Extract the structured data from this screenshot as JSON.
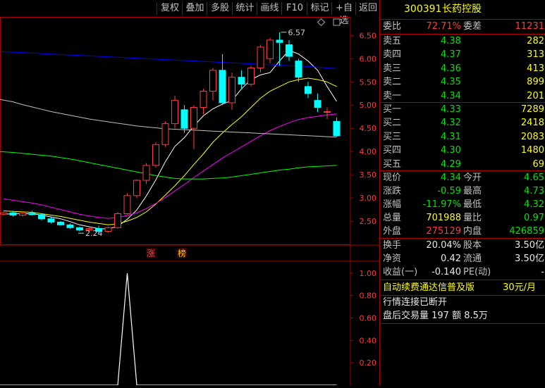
{
  "toolbar": {
    "buttons": [
      "复权",
      "叠加",
      "多股",
      "统计",
      "画线",
      "F10",
      "标记",
      "+自选",
      "返回"
    ]
  },
  "stock": {
    "code": "300391",
    "name": "长药控股"
  },
  "colors": {
    "up": "#ff3c3c",
    "down": "#00ffff",
    "ma5": "#ffffff",
    "ma10": "#ffff00",
    "ma20": "#ff00ff",
    "ma60": "#00ff00",
    "ma120": "#c0c0c0",
    "ma250": "#0000ff"
  },
  "committee": {
    "ratio_label": "委比",
    "ratio": "72.71%",
    "diff_label": "委差",
    "diff": "11231"
  },
  "asks": [
    {
      "label": "卖五",
      "price": "4.38",
      "vol": "282"
    },
    {
      "label": "卖四",
      "price": "4.37",
      "vol": "313"
    },
    {
      "label": "卖三",
      "price": "4.36",
      "vol": "413"
    },
    {
      "label": "卖二",
      "price": "4.35",
      "vol": "899"
    },
    {
      "label": "卖一",
      "price": "4.34",
      "vol": "201"
    }
  ],
  "bids": [
    {
      "label": "买一",
      "price": "4.33",
      "vol": "7289"
    },
    {
      "label": "买二",
      "price": "4.32",
      "vol": "2418"
    },
    {
      "label": "买三",
      "price": "4.31",
      "vol": "2083"
    },
    {
      "label": "买四",
      "price": "4.30",
      "vol": "1480"
    },
    {
      "label": "买五",
      "price": "4.29",
      "vol": "69"
    }
  ],
  "quote": [
    {
      "l1": "现价",
      "v1": "4.34",
      "c1": "green",
      "l2": "今开",
      "v2": "4.65",
      "c2": "green"
    },
    {
      "l1": "涨跌",
      "v1": "-0.59",
      "c1": "green",
      "l2": "最高",
      "v2": "4.73",
      "c2": "green"
    },
    {
      "l1": "涨幅",
      "v1": "-11.97%",
      "c1": "green",
      "l2": "最低",
      "v2": "4.32",
      "c2": "green"
    },
    {
      "l1": "总量",
      "v1": "701988",
      "c1": "yellow",
      "l2": "量比",
      "v2": "0.97",
      "c2": "green"
    },
    {
      "l1": "外盘",
      "v1": "275129",
      "c1": "red",
      "l2": "内盘",
      "v2": "426859",
      "c2": "green"
    }
  ],
  "fundamentals": [
    {
      "l1": "换手",
      "v1": "20.04%",
      "l2": "股本",
      "v2": "3.50亿"
    },
    {
      "l1": "净资",
      "v1": "0.42",
      "l2": "流通",
      "v2": "3.50亿"
    },
    {
      "l1": "收益(一)",
      "v1": "-0.140",
      "l2": "PE(动)",
      "v2": "-"
    }
  ],
  "ad": {
    "text": "自动续费通达信普及版",
    "price": "30元/月"
  },
  "status": {
    "line1": "行情连接已断开",
    "line2": "盘后交易量 197 额 8.5万"
  },
  "chart_data": {
    "type": "candlestick",
    "price_axis": {
      "min": 2.0,
      "max": 6.9,
      "ticks": [
        "6.50",
        "6.00",
        "5.50",
        "5.00",
        "4.50",
        "4.00",
        "3.50",
        "3.00",
        "2.50"
      ]
    },
    "indicator_axis": {
      "min": 0,
      "max": 1.1,
      "ticks": [
        "1.00",
        "0.80",
        "0.60",
        "0.40",
        "0.20"
      ]
    },
    "annotations": {
      "high": "6.57",
      "low": "2.24",
      "tags": [
        "涨",
        "榜"
      ]
    },
    "candles": [
      [
        2.65,
        2.7,
        2.62,
        2.68
      ],
      [
        2.68,
        2.72,
        2.6,
        2.63
      ],
      [
        2.63,
        2.7,
        2.6,
        2.67
      ],
      [
        2.67,
        2.72,
        2.62,
        2.64
      ],
      [
        2.64,
        2.66,
        2.52,
        2.55
      ],
      [
        2.55,
        2.58,
        2.45,
        2.48
      ],
      [
        2.48,
        2.5,
        2.4,
        2.42
      ],
      [
        2.42,
        2.45,
        2.33,
        2.36
      ],
      [
        2.36,
        2.38,
        2.28,
        2.31
      ],
      [
        2.31,
        2.36,
        2.26,
        2.34
      ],
      [
        2.34,
        2.4,
        2.24,
        2.28
      ],
      [
        2.28,
        2.38,
        2.25,
        2.36
      ],
      [
        2.36,
        2.7,
        2.34,
        2.66
      ],
      [
        2.66,
        3.1,
        2.64,
        3.05
      ],
      [
        3.05,
        3.4,
        3.0,
        3.38
      ],
      [
        3.38,
        3.75,
        3.3,
        3.7
      ],
      [
        3.7,
        4.2,
        3.65,
        4.15
      ],
      [
        4.15,
        4.65,
        4.1,
        4.6
      ],
      [
        4.6,
        5.2,
        4.5,
        5.1
      ],
      [
        4.9,
        5.0,
        4.4,
        4.5
      ],
      [
        4.5,
        5.0,
        4.05,
        4.95
      ],
      [
        4.95,
        5.35,
        4.8,
        5.3
      ],
      [
        5.3,
        5.8,
        5.1,
        5.75
      ],
      [
        5.75,
        6.1,
        5.0,
        5.05
      ],
      [
        5.05,
        5.7,
        4.9,
        5.6
      ],
      [
        5.6,
        5.75,
        5.35,
        5.45
      ],
      [
        5.45,
        5.85,
        5.4,
        5.8
      ],
      [
        5.8,
        6.3,
        5.7,
        6.25
      ],
      [
        6.0,
        6.45,
        5.9,
        6.4
      ],
      [
        6.4,
        6.57,
        5.85,
        6.35
      ],
      [
        6.3,
        6.4,
        5.95,
        6.05
      ],
      [
        5.95,
        6.0,
        5.5,
        5.6
      ],
      [
        5.4,
        5.5,
        5.15,
        5.25
      ],
      [
        5.1,
        5.25,
        4.85,
        4.95
      ],
      [
        4.85,
        4.95,
        4.7,
        4.86
      ],
      [
        4.65,
        4.73,
        4.32,
        4.34
      ]
    ],
    "series": [
      {
        "name": "MA5",
        "values": [
          2.65,
          2.66,
          2.66,
          2.66,
          2.63,
          2.59,
          2.55,
          2.49,
          2.42,
          2.38,
          2.34,
          2.33,
          2.39,
          2.54,
          2.74,
          3.04,
          3.39,
          3.78,
          4.11,
          4.3,
          4.55,
          4.77,
          4.92,
          5.02,
          5.1,
          5.35,
          5.55,
          5.65,
          5.7,
          5.95,
          6.18,
          6.1,
          5.95,
          5.75,
          5.4,
          5.08
        ]
      },
      {
        "name": "MA10",
        "values": [
          2.72,
          2.71,
          2.7,
          2.69,
          2.66,
          2.63,
          2.6,
          2.56,
          2.52,
          2.48,
          2.45,
          2.42,
          2.44,
          2.5,
          2.58,
          2.7,
          2.87,
          3.06,
          3.26,
          3.48,
          3.72,
          3.95,
          4.2,
          4.4,
          4.58,
          4.75,
          4.95,
          5.15,
          5.3,
          5.4,
          5.5,
          5.55,
          5.58,
          5.55,
          5.5,
          5.4
        ]
      },
      {
        "name": "MA20",
        "values": [
          2.98,
          2.95,
          2.92,
          2.89,
          2.85,
          2.8,
          2.75,
          2.7,
          2.65,
          2.61,
          2.58,
          2.56,
          2.58,
          2.62,
          2.68,
          2.77,
          2.88,
          3.01,
          3.15,
          3.29,
          3.44,
          3.58,
          3.72,
          3.86,
          3.98,
          4.1,
          4.22,
          4.34,
          4.45,
          4.54,
          4.62,
          4.69,
          4.73,
          4.76,
          4.79,
          4.81
        ]
      },
      {
        "name": "MA60",
        "values": [
          4.0,
          3.98,
          3.96,
          3.94,
          3.92,
          3.9,
          3.87,
          3.84,
          3.8,
          3.76,
          3.72,
          3.68,
          3.64,
          3.6,
          3.56,
          3.52,
          3.48,
          3.45,
          3.42,
          3.41,
          3.41,
          3.41,
          3.42,
          3.43,
          3.45,
          3.48,
          3.51,
          3.54,
          3.57,
          3.6,
          3.62,
          3.65,
          3.67,
          3.68,
          3.69,
          3.7
        ]
      },
      {
        "name": "MA120",
        "values": [
          5.12,
          5.07,
          5.01,
          4.96,
          4.91,
          4.86,
          4.82,
          4.78,
          4.74,
          4.7,
          4.67,
          4.64,
          4.61,
          4.58,
          4.55,
          4.53,
          4.51,
          4.49,
          4.48,
          4.47,
          4.46,
          4.45,
          4.44,
          4.43,
          4.42,
          4.41,
          4.4,
          4.39,
          4.38,
          4.37,
          4.36,
          4.35,
          4.34,
          4.33,
          4.32,
          4.31
        ]
      },
      {
        "name": "MA250",
        "values": [
          6.15,
          6.14,
          6.13,
          6.12,
          6.11,
          6.1,
          6.09,
          6.08,
          6.07,
          6.06,
          6.05,
          6.04,
          6.03,
          6.02,
          6.01,
          6.0,
          5.99,
          5.98,
          5.97,
          5.96,
          5.95,
          5.94,
          5.93,
          5.92,
          5.91,
          5.9,
          5.89,
          5.88,
          5.87,
          5.86,
          5.85,
          5.84,
          5.83,
          5.82,
          5.8,
          5.79
        ]
      }
    ],
    "indicator": [
      0,
      0,
      0,
      0,
      0,
      0,
      0,
      0,
      0,
      0,
      0,
      0,
      0,
      0,
      0,
      0,
      0,
      0,
      0,
      0,
      0,
      0,
      0,
      0,
      0,
      0,
      0,
      0,
      0,
      0,
      0,
      0,
      0,
      0,
      0,
      0
    ]
  }
}
